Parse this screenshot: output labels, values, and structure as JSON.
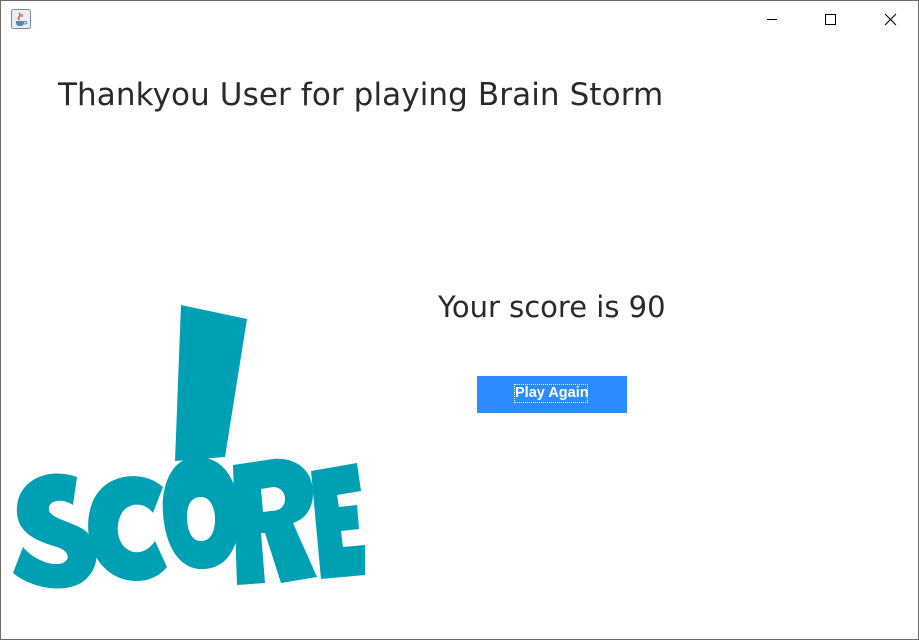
{
  "window": {
    "title": "",
    "controls": {
      "minimize_icon": "minimize-icon",
      "maximize_icon": "maximize-icon",
      "close_icon": "close-icon"
    }
  },
  "main": {
    "thanks_message": "Thankyou User for playing Brain Storm",
    "score_message": "Your score is 90",
    "play_again_label": "Play Again"
  },
  "logo": {
    "text": "SCORE!",
    "color": "#00a0b4"
  },
  "colors": {
    "button_bg": "#2b8cff",
    "button_text": "#ffffff",
    "text": "#2a2a2a",
    "logo": "#00a0b4"
  }
}
